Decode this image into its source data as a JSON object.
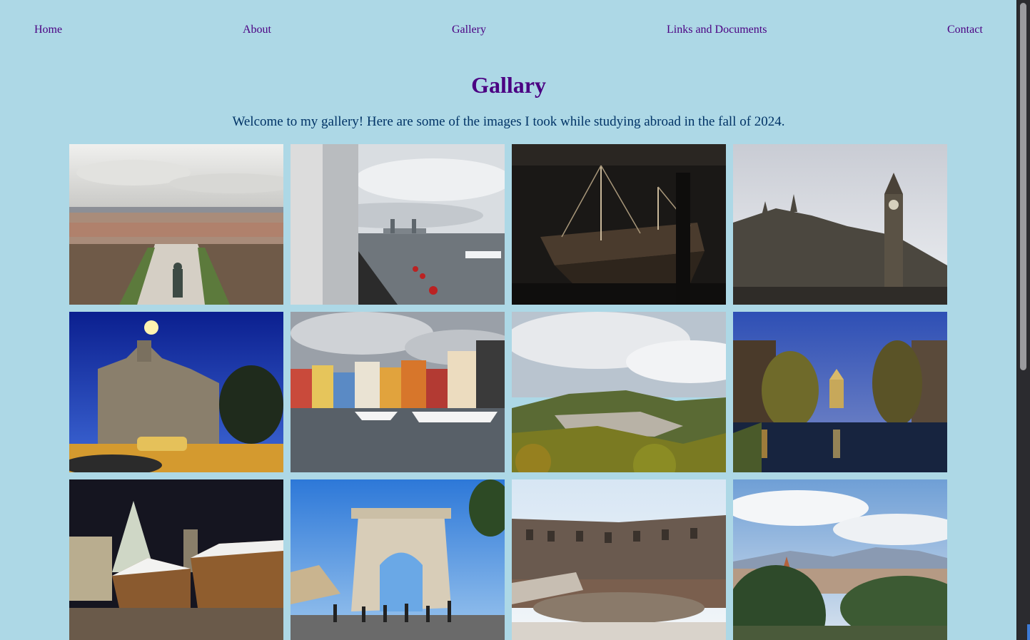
{
  "nav": {
    "home": "Home",
    "about": "About",
    "gallery": "Gallery",
    "links": "Links and Documents",
    "contact": "Contact"
  },
  "page": {
    "title": "Gallary",
    "intro": "Welcome to my gallery! Here are some of the images I took while studying abroad in the fall of 2024."
  },
  "colors": {
    "background": "#add8e6",
    "heading": "#4b0082",
    "intro_text": "#003366"
  },
  "photos": [
    {
      "subject": "city-overlook-with-statue"
    },
    {
      "subject": "river-with-tower-bridge"
    },
    {
      "subject": "historic-ship-in-museum"
    },
    {
      "subject": "parliament-and-clock-tower"
    },
    {
      "subject": "church-at-night"
    },
    {
      "subject": "colorful-harbor-houses"
    },
    {
      "subject": "forested-valley-town"
    },
    {
      "subject": "canal-at-dusk"
    },
    {
      "subject": "christmas-market-at-night"
    },
    {
      "subject": "triumphal-arch"
    },
    {
      "subject": "colosseum-interior"
    },
    {
      "subject": "city-panorama-with-hills"
    }
  ]
}
